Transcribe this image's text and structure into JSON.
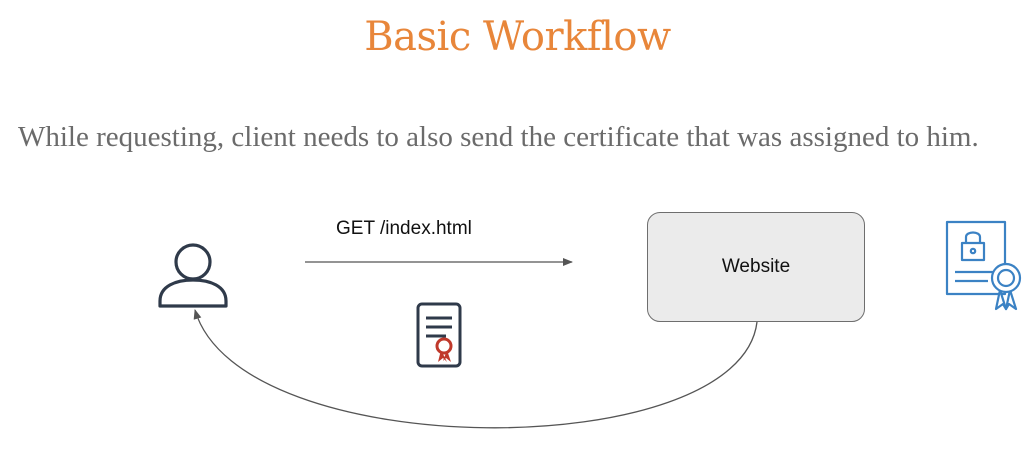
{
  "slide": {
    "title": "Basic Workflow",
    "subtitle": "While requesting, client needs to also send the certificate that was assigned to him."
  },
  "diagram": {
    "client_icon": "user-icon",
    "request_label": "GET /index.html",
    "request_document_icon": "certificate-document-icon",
    "server_label": "Website",
    "server_certificate_icon": "certificate-lock-icon",
    "colors": {
      "title": "#e8863a",
      "subtitle": "#6b6b6b",
      "outline": "#2f3a4a",
      "seal_red": "#c0392b",
      "cert_blue": "#3b82c4",
      "box_fill": "#ebebeb"
    }
  }
}
